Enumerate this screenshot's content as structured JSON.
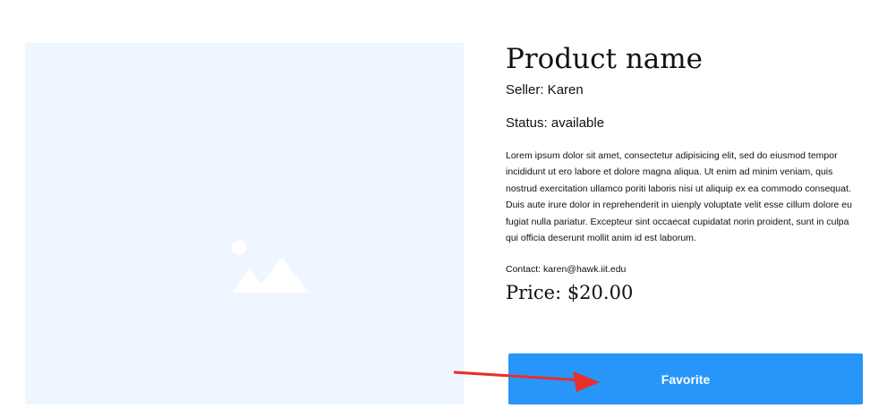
{
  "product": {
    "title": "Product name",
    "seller": "Seller: Karen",
    "status": "Status: available",
    "description": "Lorem ipsum dolor sit amet, consectetur adipisicing elit, sed do eiusmod tempor incididunt ut ero labore et dolore magna aliqua. Ut enim ad minim veniam, quis nostrud exercitation ullamco poriti laboris nisi ut aliquip ex ea commodo consequat. Duis aute irure dolor in reprehenderit in uienply voluptate velit esse cillum dolore eu fugiat nulla pariatur. Excepteur sint occaecat cupidatat norin proident, sunt in culpa qui officia deserunt mollit anim id est laborum.",
    "contact": "Contact: karen@hawk.iit.edu",
    "price": "Price: $20.00"
  },
  "actions": {
    "favorite_label": "Favorite"
  },
  "image": {
    "icon": "image-placeholder-icon",
    "background_color": "#f0f6ff"
  },
  "colors": {
    "button": "#2896f8",
    "annotation_arrow": "#e8302a"
  },
  "annotation": {
    "icon": "red-arrow-icon"
  }
}
